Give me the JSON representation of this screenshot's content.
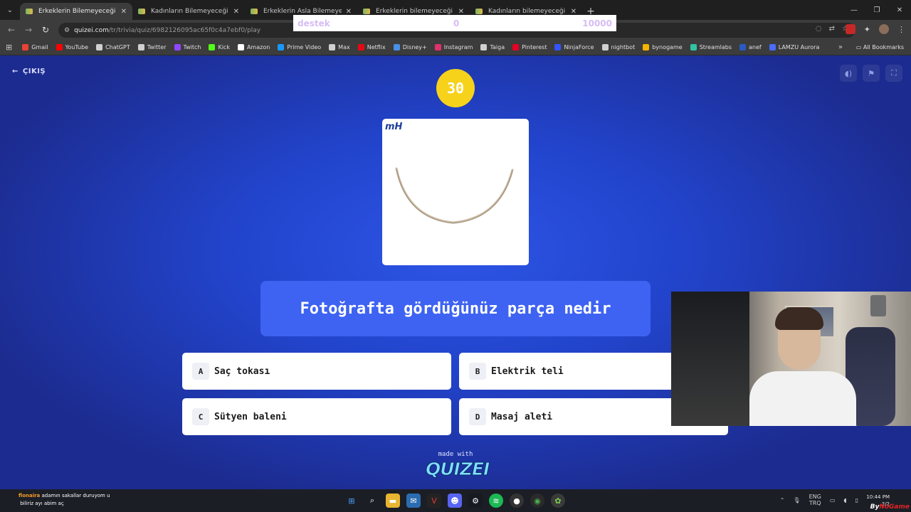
{
  "browser": {
    "tabs": [
      {
        "title": "Erkeklerin Bilemeyeceği Şeyler -",
        "active": true
      },
      {
        "title": "Kadınların Bilemeyeceği Şeyler",
        "active": false
      },
      {
        "title": "Erkeklerin Asla Bilemeyeceği Şe",
        "active": false
      },
      {
        "title": "Erkeklerin bilemeyeceği şeyler",
        "active": false
      },
      {
        "title": "Kadınların bilemeyeceği şeyler",
        "active": false
      }
    ],
    "url_host": "quizei.com",
    "url_path": "/tr/trivia/quiz/6982126095ac65f0c4a7ebf0/play",
    "bookmarks": [
      {
        "label": "Gmail",
        "color": "#ea4335"
      },
      {
        "label": "YouTube",
        "color": "#ff0000"
      },
      {
        "label": "ChatGPT",
        "color": "#d0d0d0"
      },
      {
        "label": "Twitter",
        "color": "#d0d0d0"
      },
      {
        "label": "Twitch",
        "color": "#9146ff"
      },
      {
        "label": "Kick",
        "color": "#53fc18"
      },
      {
        "label": "Amazon",
        "color": "#ffffff"
      },
      {
        "label": "Prime Video",
        "color": "#1a98ff"
      },
      {
        "label": "Max",
        "color": "#d0d0d0"
      },
      {
        "label": "Netflix",
        "color": "#e50914"
      },
      {
        "label": "Disney+",
        "color": "#4a8fe7"
      },
      {
        "label": "Instagram",
        "color": "#e1306c"
      },
      {
        "label": "Taiga",
        "color": "#d0d0d0"
      },
      {
        "label": "Pinterest",
        "color": "#e60023"
      },
      {
        "label": "NinjaForce",
        "color": "#3355ff"
      },
      {
        "label": "nightbot",
        "color": "#d0d0d0"
      },
      {
        "label": "bynogame",
        "color": "#f4b400"
      },
      {
        "label": "Streamlabs",
        "color": "#31c3a2"
      },
      {
        "label": "anef",
        "color": "#2b59c3"
      },
      {
        "label": "LAMZU Aurora",
        "color": "#4a6cff"
      }
    ],
    "all_bookmarks_label": "All Bookmarks"
  },
  "overlay": {
    "label": "destek",
    "current": "0",
    "goal": "10000"
  },
  "quiz": {
    "exit_label": "ÇIKIŞ",
    "timer": "30",
    "brand_logo": "mH",
    "question": "Fotoğrafta gördüğünüz parça nedir",
    "answers": [
      {
        "letter": "A",
        "text": "Saç tokası"
      },
      {
        "letter": "B",
        "text": "Elektrik teli"
      },
      {
        "letter": "C",
        "text": "Sütyen baleni"
      },
      {
        "letter": "D",
        "text": "Masaj aleti"
      }
    ],
    "made_with": "made with",
    "logo_text": "QUIZEI"
  },
  "chat": {
    "line1_user": "flonaira",
    "line1_text": "adamın sakallar duruyom u",
    "line2_user": "",
    "line2_text": "biliriz ayı abim aç"
  },
  "taskbar": {
    "lang_top": "ENG",
    "lang_bottom": "TRQ",
    "time": "10:44 PM",
    "date": "3/2"
  },
  "watermark": {
    "prefix": "By",
    "name": "NoGame"
  },
  "colors": {
    "stage": "#2244cc",
    "timer": "#f6d21a",
    "question_bg": "#3e63f2"
  }
}
